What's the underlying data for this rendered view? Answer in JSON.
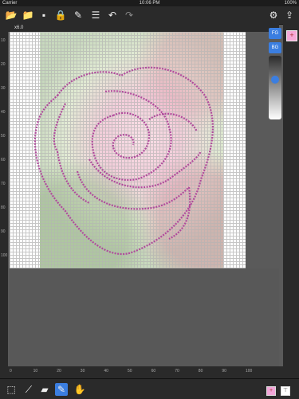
{
  "status": {
    "carrier": "Carrier",
    "time": "10:06 PM",
    "battery": "100%"
  },
  "toolbar": {
    "open_icon": "folder-icon",
    "import_icon": "folder-plus-icon",
    "save_icon": "save-icon",
    "lock_icon": "lock-icon",
    "pencil_icon": "pencil-menu-icon",
    "list_icon": "list-icon",
    "undo_icon": "undo-icon",
    "redo_icon": "redo-icon",
    "settings_icon": "gear-icon",
    "share_icon": "share-icon"
  },
  "zoom": "x6.0",
  "panel": {
    "fg_label": "FG",
    "bg_label": "BG",
    "slider_value": 0.35
  },
  "ruler": {
    "left_ticks": [
      "10",
      "20",
      "30",
      "40",
      "50",
      "60",
      "70",
      "80",
      "90",
      "100"
    ],
    "bottom_ticks": [
      "0",
      "10",
      "20",
      "30",
      "40",
      "50",
      "60",
      "70",
      "80",
      "90",
      "100"
    ]
  },
  "bottom": {
    "select_icon": "select-rect-icon",
    "eyedropper_icon": "eyedropper-icon",
    "eraser_icon": "eraser-icon",
    "pen_icon": "pen-icon",
    "hand_icon": "hand-icon",
    "swatch_icon": "add-color-icon"
  },
  "colors": {
    "accent": "#3b7ee0",
    "stroke": "#b04a9c",
    "swatch": "#f2a7d9"
  }
}
